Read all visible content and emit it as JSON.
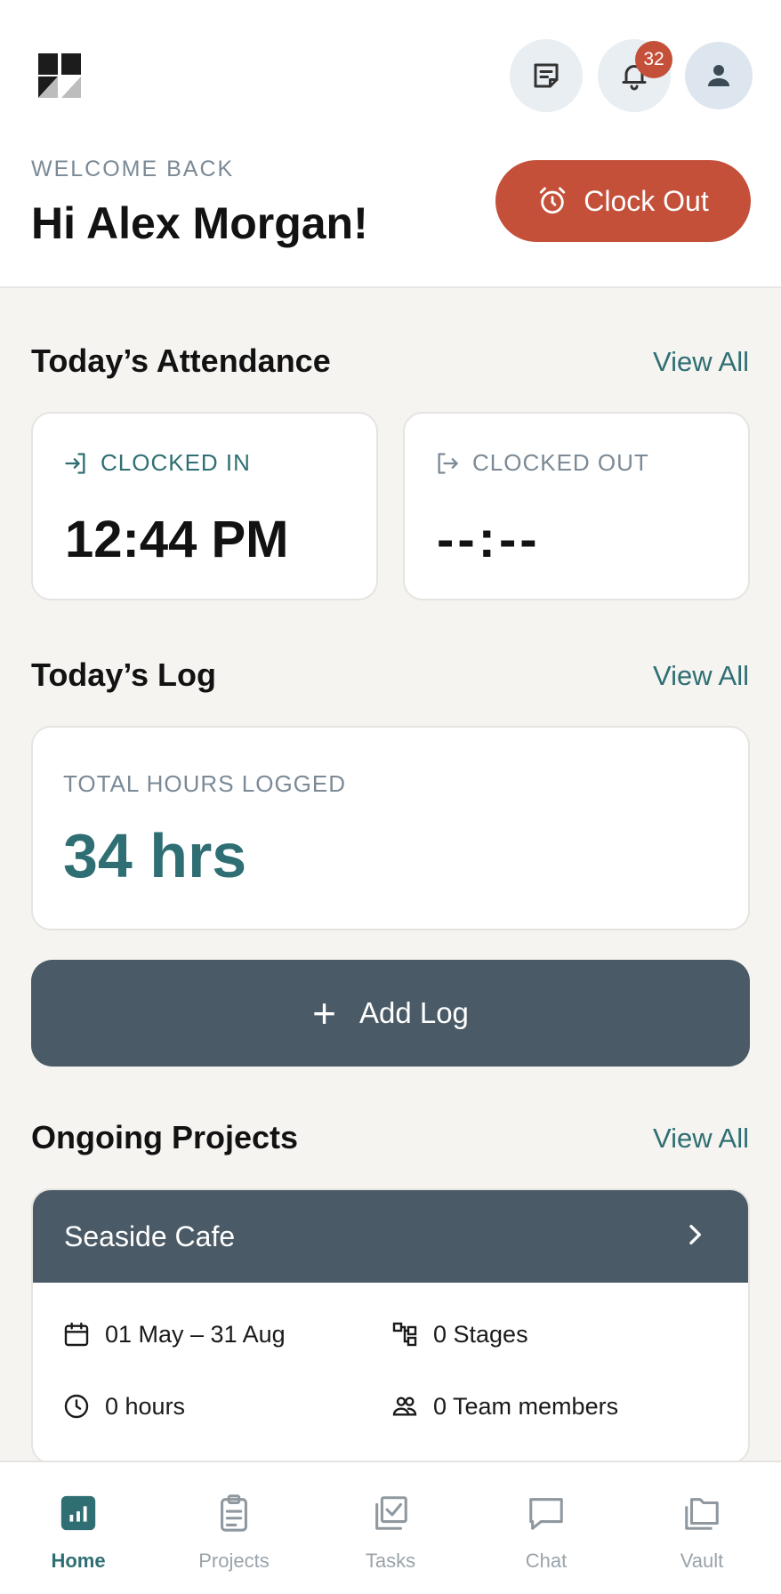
{
  "header": {
    "welcome": "WELCOME BACK",
    "greeting": "Hi Alex Morgan!",
    "notification_count": "32",
    "clock_out_label": "Clock Out",
    "icons": [
      "logo-icon",
      "notes-icon",
      "bell-icon",
      "user-icon",
      "alarm-clock-icon"
    ]
  },
  "attendance": {
    "title": "Today’s Attendance",
    "view_all": "View All",
    "clocked_in_label": "CLOCKED IN",
    "clocked_in_time": "12:44 PM",
    "clocked_out_label": "CLOCKED OUT",
    "clocked_out_time": "--:--"
  },
  "log": {
    "title": "Today’s Log",
    "view_all": "View All",
    "total_label": "TOTAL HOURS LOGGED",
    "total_value": "34 hrs",
    "add_label": "Add Log",
    "add_icon": "+"
  },
  "projects": {
    "title": "Ongoing Projects",
    "view_all": "View All",
    "items": [
      {
        "name": "Seaside Cafe",
        "dates": "01 May – 31 Aug",
        "stages": "0 Stages",
        "hours": "0 hours",
        "members": "0 Team members"
      }
    ]
  },
  "nav": {
    "items": [
      {
        "label": "Home",
        "icon": "home-chart-icon",
        "active": true
      },
      {
        "label": "Projects",
        "icon": "clipboard-icon",
        "active": false
      },
      {
        "label": "Tasks",
        "icon": "tasks-check-icon",
        "active": false
      },
      {
        "label": "Chat",
        "icon": "chat-bubble-icon",
        "active": false
      },
      {
        "label": "Vault",
        "icon": "folder-icon",
        "active": false
      }
    ]
  },
  "colors": {
    "accent_red": "#c4503a",
    "accent_teal": "#2f6f73",
    "slate": "#4a5a66",
    "muted": "#7b8a96",
    "background": "#f5f4f1"
  }
}
